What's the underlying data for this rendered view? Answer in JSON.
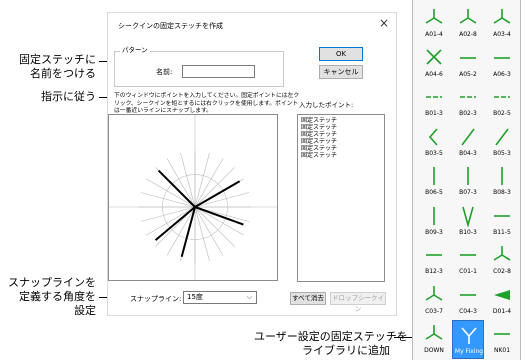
{
  "callouts": {
    "name_stitch": [
      "固定ステッチに",
      "名前をつける"
    ],
    "follow_instructions": "指示に従う",
    "snap_angle": [
      "スナップラインを",
      "定義する角度を",
      "設定"
    ],
    "add_to_library": [
      "ユーザー設定の固定ステッチを",
      "ライブラリに追加"
    ]
  },
  "dialog": {
    "title": "シークインの固定ステッチを作成",
    "close_glyph": "×",
    "group_label": "パターン",
    "name_label": "名前:",
    "name_value": "",
    "ok_label": "OK",
    "cancel_label": "キャンセル",
    "instructions": "下のウィンドウにポイントを入力してください。固定ポイントには左クリック、シークインを短とするには右クリックを使用します。ポイントは一番近いラインにスナップします。",
    "entered_points_label": "入力したポイント:",
    "entered_points": [
      "固定ステッチ",
      "固定ステッチ",
      "固定ステッチ",
      "固定ステッチ",
      "固定ステッチ",
      "固定ステッチ"
    ],
    "snap_label": "スナップライン:",
    "snap_value": "15度",
    "clear_all_label": "すべて消去",
    "drop_sequin_label": "ドロップシークイン",
    "snap_angle_degrees": 15,
    "stitch_angles_degrees": [
      135,
      30,
      -20,
      -105,
      -140
    ]
  },
  "palette": {
    "items": [
      {
        "label": "A01-4",
        "icon": "y-three-prong-icon"
      },
      {
        "label": "A02-8",
        "icon": "y-three-prong-icon"
      },
      {
        "label": "A03-4",
        "icon": "y-three-prong-icon"
      },
      {
        "label": "A04-6",
        "icon": "x-cross-icon"
      },
      {
        "label": "A05-2",
        "icon": "horizontal-line-icon"
      },
      {
        "label": "A06-3",
        "icon": "horizontal-line-icon"
      },
      {
        "label": "B01-3",
        "icon": "dashed-line-icon"
      },
      {
        "label": "B02-3",
        "icon": "dashed-line-icon"
      },
      {
        "label": "B02-5",
        "icon": "dashed-line-icon"
      },
      {
        "label": "B03-5",
        "icon": "chevron-left-icon"
      },
      {
        "label": "B04-3",
        "icon": "diagonal-line-icon"
      },
      {
        "label": "B05-3",
        "icon": "diagonal-line-icon"
      },
      {
        "label": "B06-5",
        "icon": "vertical-line-icon"
      },
      {
        "label": "B07-3",
        "icon": "vertical-line-icon"
      },
      {
        "label": "B08-3",
        "icon": "vertical-line-icon"
      },
      {
        "label": "B09-3",
        "icon": "vertical-line-icon"
      },
      {
        "label": "B10-3",
        "icon": "v-shape-icon"
      },
      {
        "label": "B11-5",
        "icon": "horizontal-line-icon"
      },
      {
        "label": "B12-3",
        "icon": "horizontal-line-icon"
      },
      {
        "label": "C01-1",
        "icon": "horizontal-line-icon"
      },
      {
        "label": "C02-8",
        "icon": "y-three-prong-icon"
      },
      {
        "label": "C03-7",
        "icon": "y-three-prong-icon"
      },
      {
        "label": "C04-3",
        "icon": "horizontal-line-icon"
      },
      {
        "label": "D01-4",
        "icon": "wedge-icon"
      },
      {
        "label": "DOWN",
        "icon": "y-three-prong-icon"
      },
      {
        "label": "My Fixing",
        "icon": "y-custom-icon",
        "selected": true
      },
      {
        "label": "NK01",
        "icon": "horizontal-line-icon"
      }
    ]
  },
  "colors": {
    "stitch_green": "#1fa02a",
    "selection_blue": "#3399ff"
  }
}
